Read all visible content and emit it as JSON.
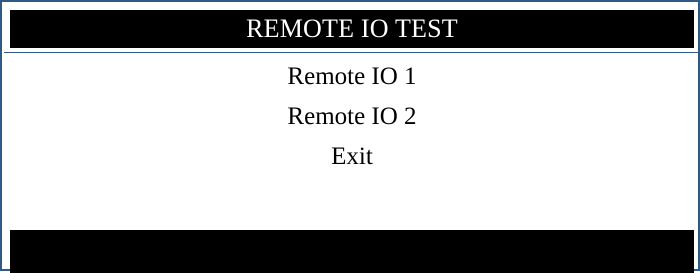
{
  "header": {
    "title": "REMOTE IO TEST"
  },
  "menu": {
    "items": [
      {
        "label": "Remote IO 1"
      },
      {
        "label": "Remote IO 2"
      },
      {
        "label": "Exit"
      }
    ]
  },
  "colors": {
    "frame_border": "#2f5a86",
    "bar_background": "#000000",
    "title_text": "#ffffff",
    "panel_background": "#ffffff"
  }
}
